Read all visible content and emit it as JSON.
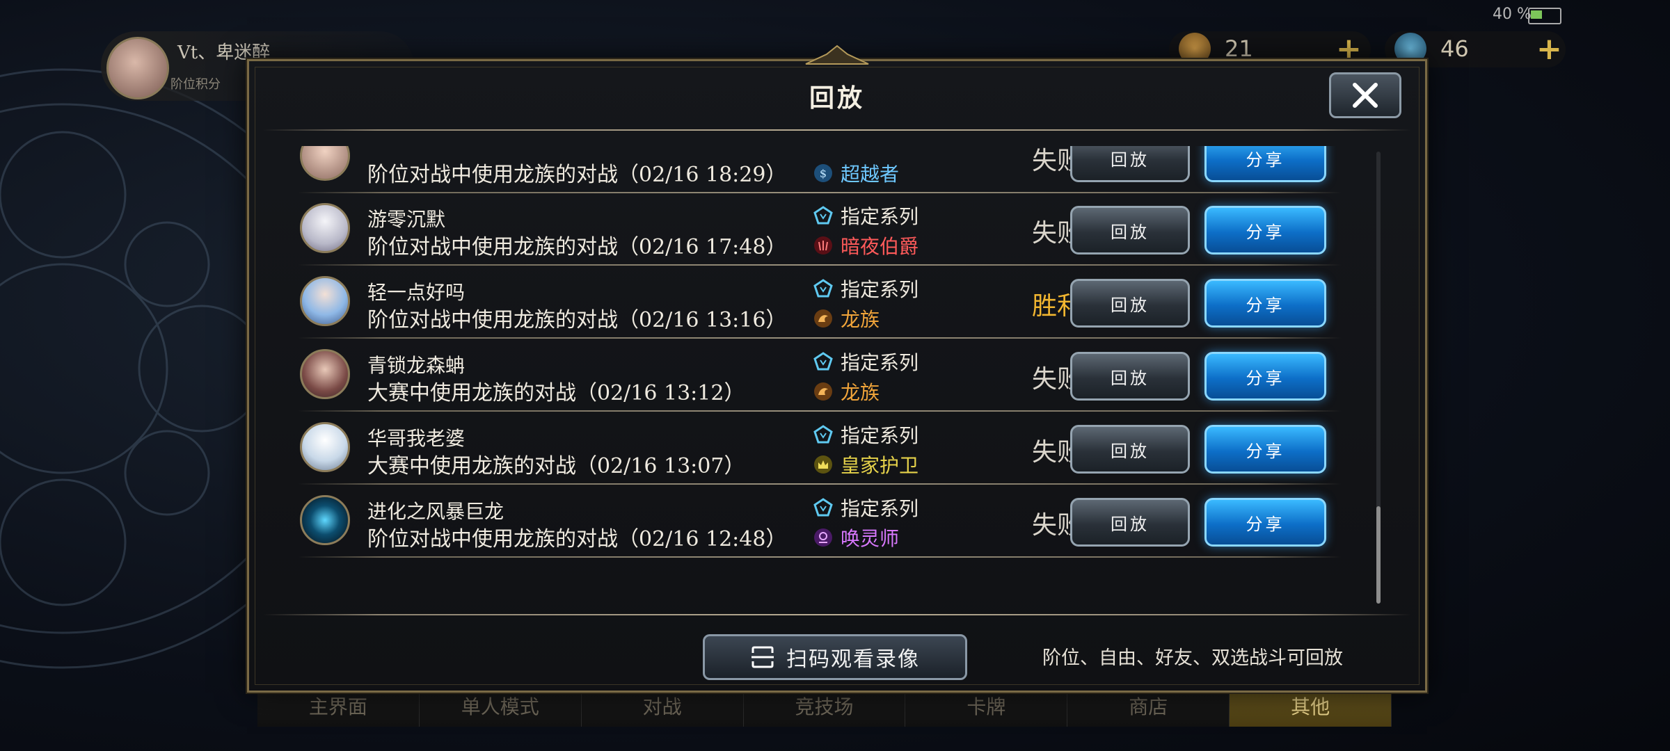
{
  "status": {
    "battery": "40 %"
  },
  "player": {
    "name": "Vt、卑迷醉",
    "rank": "阶位积分"
  },
  "currency": [
    {
      "icon": "gold-coin-icon",
      "value": "21"
    },
    {
      "icon": "crystal-icon",
      "value": "46"
    }
  ],
  "bottom_nav": [
    {
      "label": "主界面"
    },
    {
      "label": "单人模式"
    },
    {
      "label": "对战"
    },
    {
      "label": "竞技场"
    },
    {
      "label": "卡牌"
    },
    {
      "label": "商店"
    },
    {
      "label": "其他"
    }
  ],
  "modal": {
    "title": "回放",
    "scan_button": "扫码观看录像",
    "hint": "阶位、自由、好友、双选战斗可回放"
  },
  "replays": [
    {
      "name": "",
      "desc": "阶位对战中使用龙族的对战（02/16 18:29）",
      "deck_format": "",
      "opponent_class": "超越者",
      "opponent_class_color": "#6ec8ff",
      "result": "失败",
      "replay": "回放",
      "share": "分享"
    },
    {
      "name": "游零沉默",
      "desc": "阶位对战中使用龙族的对战（02/16 17:48）",
      "deck_format": "指定系列",
      "opponent_class": "暗夜伯爵",
      "opponent_class_color": "#ff5a5a",
      "result": "失败",
      "replay": "回放",
      "share": "分享"
    },
    {
      "name": "轻一点好吗",
      "desc": "阶位对战中使用龙族的对战（02/16 13:16）",
      "deck_format": "指定系列",
      "opponent_class": "龙族",
      "opponent_class_color": "#f0a43a",
      "result": "胜利",
      "replay": "回放",
      "share": "分享"
    },
    {
      "name": "青锁龙森蚺",
      "desc": "大赛中使用龙族的对战（02/16 13:12）",
      "deck_format": "指定系列",
      "opponent_class": "龙族",
      "opponent_class_color": "#f0a43a",
      "result": "失败",
      "replay": "回放",
      "share": "分享"
    },
    {
      "name": "华哥我老婆",
      "desc": "大赛中使用龙族的对战（02/16 13:07）",
      "deck_format": "指定系列",
      "opponent_class": "皇家护卫",
      "opponent_class_color": "#e6d24a",
      "result": "失败",
      "replay": "回放",
      "share": "分享"
    },
    {
      "name": "进化之风暴巨龙",
      "desc": "阶位对战中使用龙族的对战（02/16 12:48）",
      "deck_format": "指定系列",
      "opponent_class": "唤灵师",
      "opponent_class_color": "#d978ff",
      "result": "失败",
      "replay": "回放",
      "share": "分享"
    }
  ],
  "colors": {
    "accent_gold": "#f2b630",
    "share_blue": "#0d6fc8",
    "frame_gold": "#7a6a45"
  }
}
